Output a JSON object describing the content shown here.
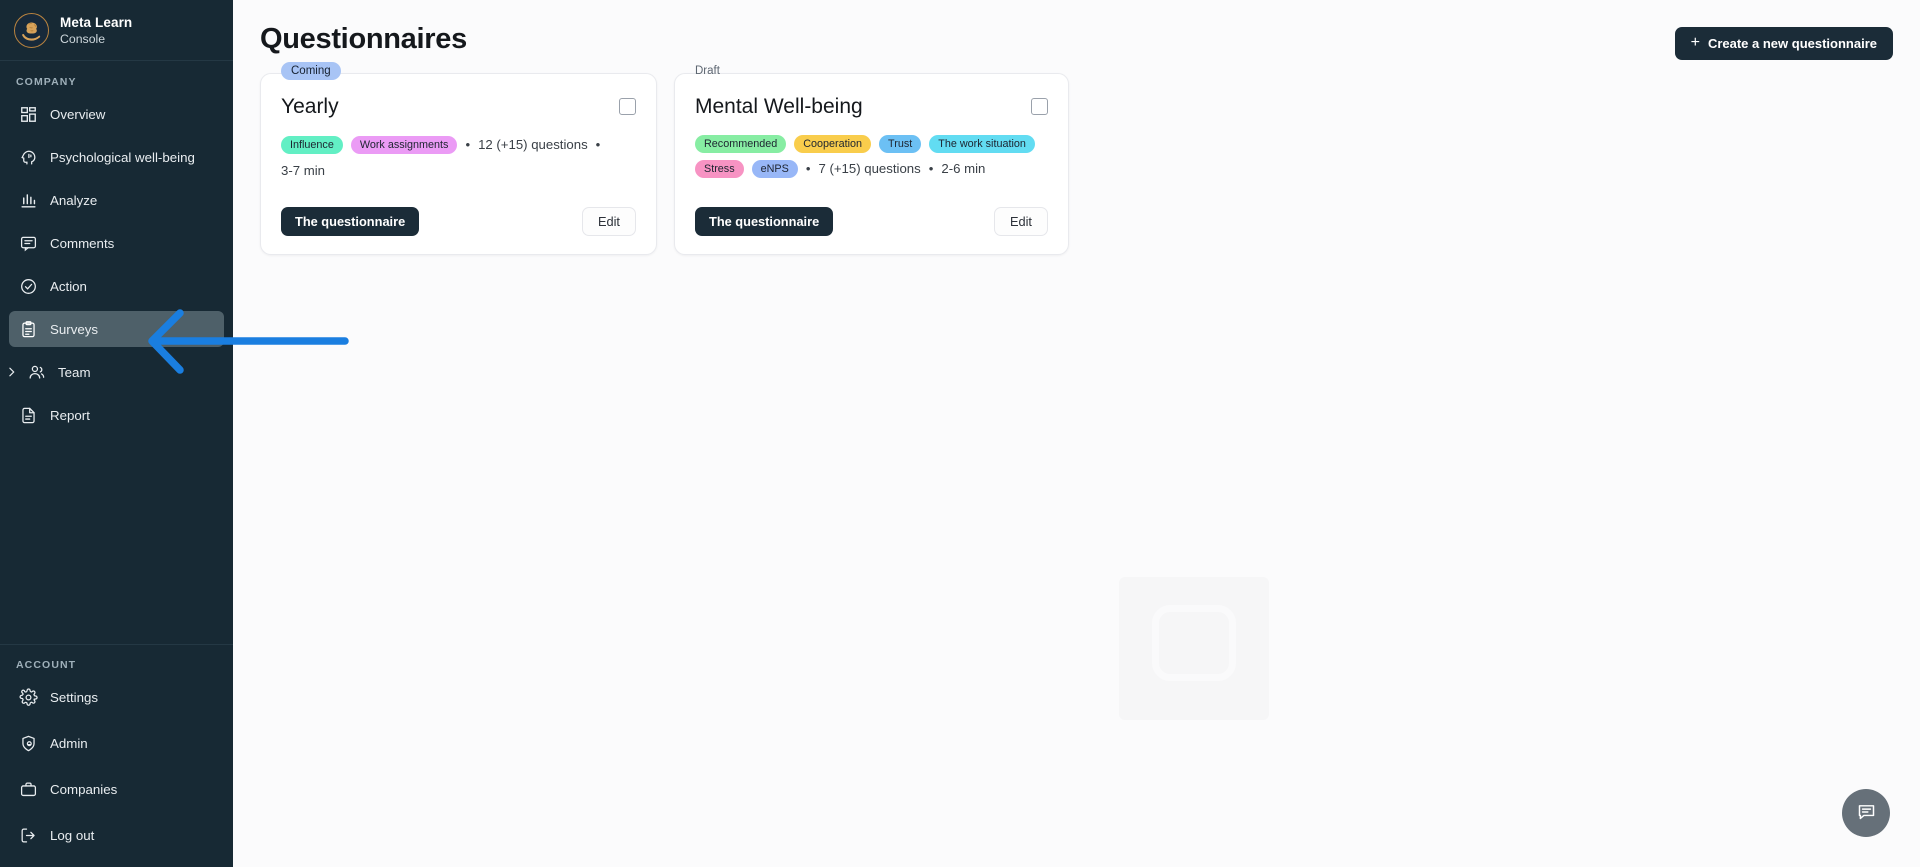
{
  "brand": {
    "title": "Meta Learn",
    "subtitle": "Console",
    "logo_icon": "brain-in-hand-logo-icon"
  },
  "sidebar": {
    "company_label": "COMPANY",
    "account_label": "ACCOUNT",
    "company_items": [
      {
        "label": "Overview",
        "icon": "grid-icon",
        "active": false
      },
      {
        "label": "Psychological well-being",
        "icon": "head-brain-icon",
        "active": false
      },
      {
        "label": "Analyze",
        "icon": "bar-chart-icon",
        "active": false
      },
      {
        "label": "Comments",
        "icon": "comment-icon",
        "active": false
      },
      {
        "label": "Action",
        "icon": "check-circle-icon",
        "active": false
      },
      {
        "label": "Surveys",
        "icon": "clipboard-icon",
        "active": true
      },
      {
        "label": "Team",
        "icon": "users-icon",
        "active": false,
        "chevron": "chevron-right-icon"
      },
      {
        "label": "Report",
        "icon": "document-icon",
        "active": false
      }
    ],
    "account_items": [
      {
        "label": "Settings",
        "icon": "gear-icon"
      },
      {
        "label": "Admin",
        "icon": "shield-user-icon"
      },
      {
        "label": "Companies",
        "icon": "briefcase-icon"
      },
      {
        "label": "Log out",
        "icon": "logout-icon"
      }
    ]
  },
  "header": {
    "title": "Questionnaires",
    "create_button": "Create a new questionnaire",
    "create_button_icon": "plus-icon"
  },
  "cards": [
    {
      "status": "Coming",
      "status_style": "coming",
      "title": "Yearly",
      "tags": [
        {
          "label": "Influence",
          "color": "#62efc4"
        },
        {
          "label": "Work assignments",
          "color": "#eb9bf5"
        }
      ],
      "questions": "12 (+15) questions",
      "duration": "3-7 min",
      "separator": "•",
      "primary_button": "The questionnaire",
      "secondary_button": "Edit",
      "checkbox_checked": false
    },
    {
      "status": "Draft",
      "status_style": "draft",
      "title": "Mental Well-being",
      "tags": [
        {
          "label": "Recommended",
          "color": "#87eda3"
        },
        {
          "label": "Cooperation",
          "color": "#f9cd4c"
        },
        {
          "label": "Trust",
          "color": "#6cc0f4"
        },
        {
          "label": "The work situation",
          "color": "#62dcf2"
        },
        {
          "label": "Stress",
          "color": "#f793c3"
        },
        {
          "label": "eNPS",
          "color": "#98b7f7"
        }
      ],
      "questions": "7 (+15) questions",
      "duration": "2-6 min",
      "separator": "•",
      "primary_button": "The questionnaire",
      "secondary_button": "Edit",
      "checkbox_checked": false
    }
  ],
  "chat": {
    "icon": "chat-bubble-icon"
  },
  "annotation": {
    "arrow_icon": "left-arrow-annotation",
    "color": "#1a7ee0",
    "points_at": "Surveys"
  },
  "colors": {
    "sidebar_bg": "#172934",
    "sidebar_active": "#4e6069",
    "accent_dark": "#1b2c38",
    "page_bg": "#fbfbfc",
    "card_bg": "#ffffff",
    "annotation_blue": "#1a7ee0"
  }
}
